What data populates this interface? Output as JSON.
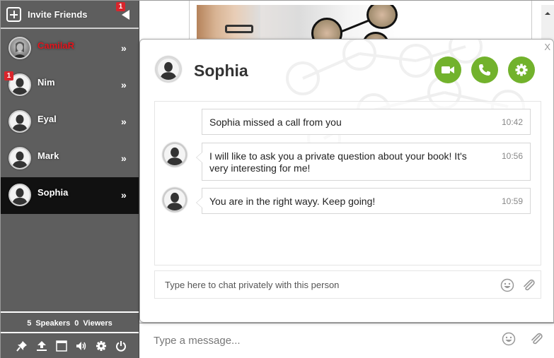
{
  "sidebar": {
    "invite": {
      "label": "Invite Friends",
      "badge": "1"
    },
    "users": [
      {
        "name": "CamilaR",
        "highlight_color": "#e2141c",
        "badge": "",
        "active": false,
        "photo": true
      },
      {
        "name": "Nim",
        "badge": "1",
        "active": false,
        "photo": false
      },
      {
        "name": "Eyal",
        "badge": "",
        "active": false,
        "photo": false
      },
      {
        "name": "Mark",
        "badge": "",
        "active": false,
        "photo": false
      },
      {
        "name": "Sophia",
        "badge": "",
        "active": true,
        "photo": false
      }
    ],
    "chevron": "»",
    "stats": {
      "speakers_count": "5",
      "speakers_label": "Speakers",
      "viewers_count": "0",
      "viewers_label": "Viewers"
    },
    "toolbar": [
      "pin-icon",
      "upload-icon",
      "window-icon",
      "volume-icon",
      "settings-icon",
      "power-icon"
    ]
  },
  "dialog": {
    "title": "Sophia",
    "close_label": "X",
    "actions": [
      "video-call",
      "voice-call",
      "settings"
    ],
    "accent_color": "#72b22c",
    "messages": [
      {
        "text": "Sophia missed a call from you",
        "time": "10:42",
        "type": "system"
      },
      {
        "text": "I will like to ask you a private question about your book! It's very interesting for me!",
        "time": "10:56",
        "type": "incoming"
      },
      {
        "text": "You are in the right wayy. Keep going!",
        "time": "10:59",
        "type": "incoming"
      }
    ],
    "input_placeholder": "Type here to chat privately with this person"
  },
  "compose": {
    "placeholder": "Type a message..."
  }
}
